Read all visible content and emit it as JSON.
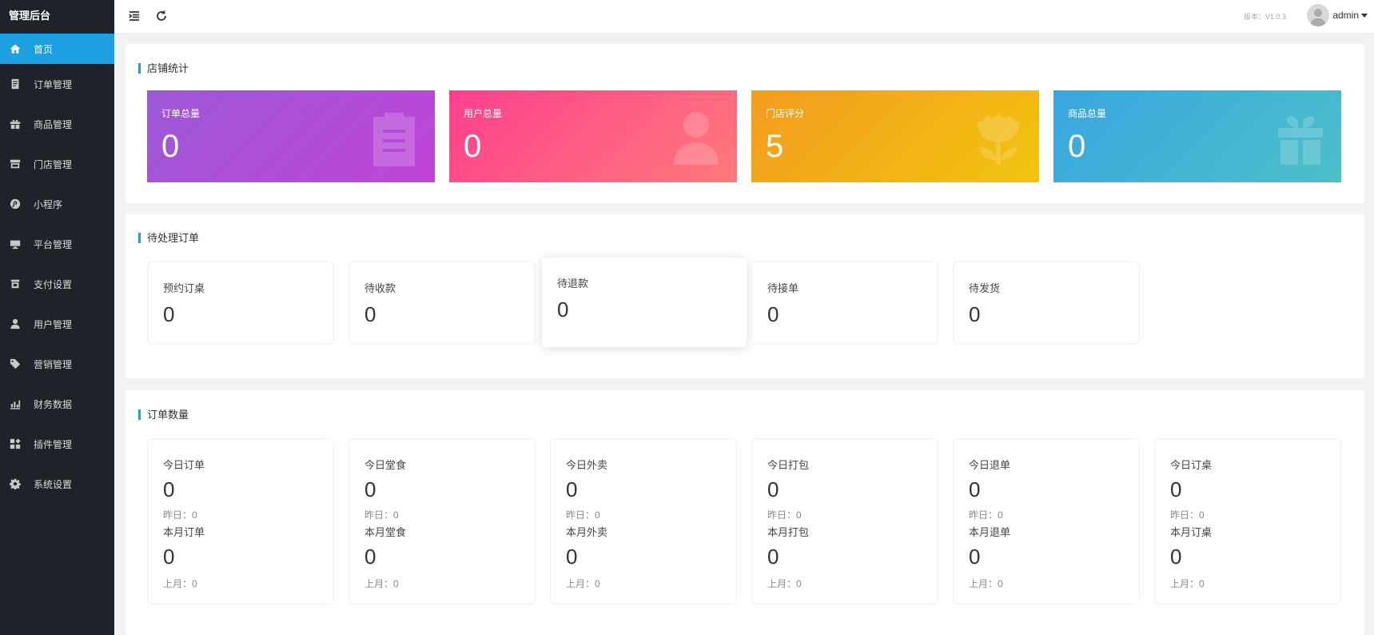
{
  "app": {
    "title": "管理后台"
  },
  "sidebar": {
    "items": [
      {
        "label": "首页",
        "icon": "home-icon",
        "active": true
      },
      {
        "label": "订单管理",
        "icon": "order-icon"
      },
      {
        "label": "商品管理",
        "icon": "gift-icon"
      },
      {
        "label": "门店管理",
        "icon": "store-icon"
      },
      {
        "label": "小程序",
        "icon": "miniprogram-icon"
      },
      {
        "label": "平台管理",
        "icon": "monitor-icon"
      },
      {
        "label": "支付设置",
        "icon": "payment-icon"
      },
      {
        "label": "用户管理",
        "icon": "user-icon"
      },
      {
        "label": "营销管理",
        "icon": "tag-icon"
      },
      {
        "label": "财务数据",
        "icon": "chart-icon"
      },
      {
        "label": "插件管理",
        "icon": "plugin-icon"
      },
      {
        "label": "系统设置",
        "icon": "gear-icon"
      }
    ]
  },
  "header": {
    "version": "版本：V1.0.3",
    "username": "admin"
  },
  "store_stats": {
    "title": "店铺统计",
    "cards": [
      {
        "label": "订单总量",
        "value": "0",
        "icon": "clipboard-icon",
        "gradient": [
          "#9b59d6",
          "#c044d8"
        ]
      },
      {
        "label": "用户总量",
        "value": "0",
        "icon": "user-icon",
        "gradient": [
          "#ff3f8e",
          "#ff7a7a"
        ]
      },
      {
        "label": "门店评分",
        "value": "5",
        "icon": "flower-icon",
        "gradient": [
          "#f39c1f",
          "#f1c40f"
        ]
      },
      {
        "label": "商品总量",
        "value": "0",
        "icon": "gift-icon",
        "gradient": [
          "#3aa6e0",
          "#4cc0c8"
        ]
      }
    ]
  },
  "pending_orders": {
    "title": "待处理订单",
    "cards": [
      {
        "label": "预约订桌",
        "value": "0"
      },
      {
        "label": "待收款",
        "value": "0"
      },
      {
        "label": "待退款",
        "value": "0"
      },
      {
        "label": "待接单",
        "value": "0"
      },
      {
        "label": "待发货",
        "value": "0"
      }
    ]
  },
  "order_counts": {
    "title": "订单数量",
    "cards": [
      {
        "today_label": "今日订单",
        "today_value": "0",
        "yesterday": "昨日：0",
        "month_label": "本月订单",
        "month_value": "0",
        "last_month": "上月：0"
      },
      {
        "today_label": "今日堂食",
        "today_value": "0",
        "yesterday": "昨日：0",
        "month_label": "本月堂食",
        "month_value": "0",
        "last_month": "上月：0"
      },
      {
        "today_label": "今日外卖",
        "today_value": "0",
        "yesterday": "昨日：0",
        "month_label": "本月外卖",
        "month_value": "0",
        "last_month": "上月：0"
      },
      {
        "today_label": "今日打包",
        "today_value": "0",
        "yesterday": "昨日：0",
        "month_label": "本月打包",
        "month_value": "0",
        "last_month": "上月：0"
      },
      {
        "today_label": "今日退单",
        "today_value": "0",
        "yesterday": "昨日：0",
        "month_label": "本月退单",
        "month_value": "0",
        "last_month": "上月：0"
      },
      {
        "today_label": "今日订桌",
        "today_value": "0",
        "yesterday": "昨日：0",
        "month_label": "本月订桌",
        "month_value": "0",
        "last_month": "上月：0"
      }
    ]
  }
}
